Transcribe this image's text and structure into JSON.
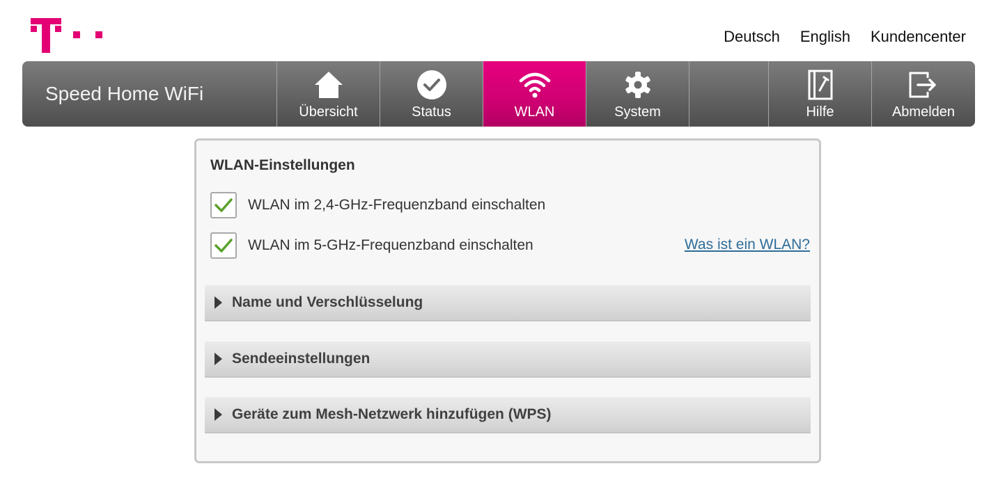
{
  "brand": {
    "logo_color": "#e20074"
  },
  "header_links": [
    {
      "label": "Deutsch"
    },
    {
      "label": "English"
    },
    {
      "label": "Kundencenter"
    }
  ],
  "navbar": {
    "product_name": "Speed Home WiFi",
    "items": [
      {
        "label": "Übersicht",
        "icon": "home-icon"
      },
      {
        "label": "Status",
        "icon": "check-circle-icon"
      },
      {
        "label": "WLAN",
        "icon": "wifi-icon",
        "active": true
      },
      {
        "label": "System",
        "icon": "gear-icon"
      },
      {
        "label": "Hilfe",
        "icon": "help-book-icon"
      },
      {
        "label": "Abmelden",
        "icon": "logout-icon"
      }
    ],
    "active_color": "#e20074"
  },
  "wlan_settings": {
    "title": "WLAN-Einstellungen",
    "checkboxes": [
      {
        "label": "WLAN im 2,4-GHz-Frequenzband einschalten",
        "checked": true
      },
      {
        "label": "WLAN im 5-GHz-Frequenzband einschalten",
        "checked": true
      }
    ],
    "help_link": "Was ist ein WLAN?",
    "sections": [
      {
        "label": "Name und Verschlüsselung",
        "expanded": false
      },
      {
        "label": "Sendeeinstellungen",
        "expanded": false
      },
      {
        "label": "Geräte zum Mesh-Netzwerk hinzufügen (WPS)",
        "expanded": false
      }
    ]
  }
}
